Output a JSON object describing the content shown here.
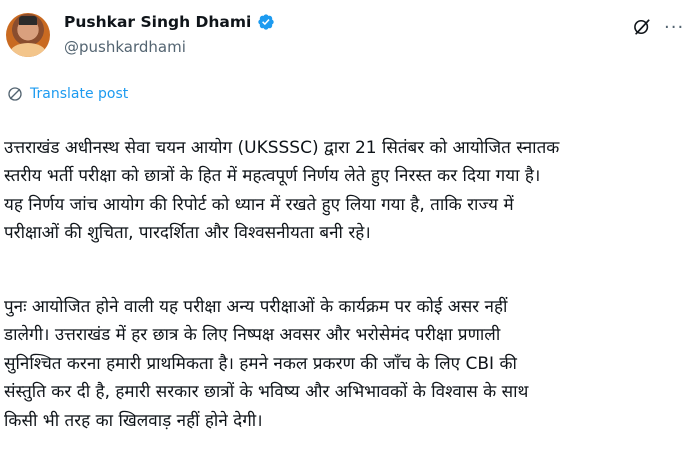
{
  "author": {
    "display_name": "Pushkar Singh Dhami",
    "handle": "@pushkardhami",
    "verified": true,
    "verified_color": "#1d9bf0"
  },
  "icons": {
    "header_right": [
      "grok-icon",
      "more-icon"
    ],
    "translate": "globe-icon"
  },
  "translate": {
    "label": "Translate post",
    "color": "#1d9bf0"
  },
  "post": {
    "paragraphs": [
      "उत्तराखंड अधीनस्थ सेवा चयन आयोग (UKSSSC) द्वारा 21 सितंबर को आयोजित स्नातक\nस्तरीय भर्ती परीक्षा को छात्रों के हित में महत्वपूर्ण निर्णय लेते हुए निरस्त कर दिया गया है।\nयह निर्णय जांच आयोग की रिपोर्ट को ध्यान में रखते हुए लिया गया है, ताकि राज्य में\nपरीक्षाओं की शुचिता, पारदर्शिता और विश्वसनीयता बनी रहे।",
      "पुनः आयोजित होने वाली यह परीक्षा अन्य परीक्षाओं के कार्यक्रम पर कोई असर नहीं\nडालेगी। उत्तराखंड में हर छात्र के लिए निष्पक्ष अवसर और भरोसेमंद परीक्षा प्रणाली\nसुनिश्चित करना हमारी प्राथमिकता है। हमने नकल प्रकरण की जाँच के लिए CBI की\nसंस्तुति कर दी है, हमारी सरकार छात्रों के भविष्य और अभिभावकों के विश्वास के साथ\nकिसी भी तरह का खिलवाड़ नहीं होने देगी।"
    ]
  }
}
